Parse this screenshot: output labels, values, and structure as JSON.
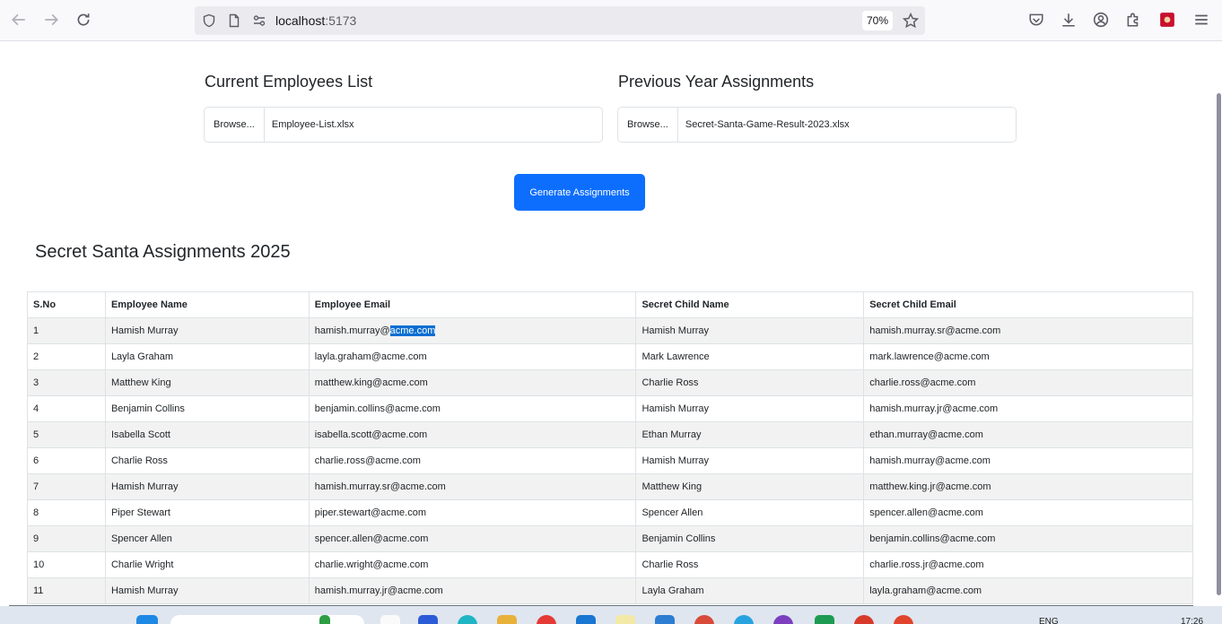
{
  "browser": {
    "url_host": "localhost",
    "url_port": ":5173",
    "zoom": "70%"
  },
  "uploads": {
    "employees": {
      "title": "Current Employees List",
      "browse_label": "Browse...",
      "file_name": "Employee-List.xlsx"
    },
    "previous": {
      "title": "Previous Year Assignments",
      "browse_label": "Browse...",
      "file_name": "Secret-Santa-Game-Result-2023.xlsx"
    }
  },
  "generate_label": "Generate Assignments",
  "results": {
    "title": "Secret Santa Assignments 2025",
    "columns": [
      "S.No",
      "Employee Name",
      "Employee Email",
      "Secret Child Name",
      "Secret Child Email"
    ],
    "rows": [
      {
        "sno": "1",
        "name": "Hamish Murray",
        "email_pre": "hamish.murray@",
        "email_sel": "acme.com",
        "child": "Hamish Murray",
        "child_email": "hamish.murray.sr@acme.com"
      },
      {
        "sno": "2",
        "name": "Layla Graham",
        "email": "layla.graham@acme.com",
        "child": "Mark Lawrence",
        "child_email": "mark.lawrence@acme.com"
      },
      {
        "sno": "3",
        "name": "Matthew King",
        "email": "matthew.king@acme.com",
        "child": "Charlie Ross",
        "child_email": "charlie.ross@acme.com"
      },
      {
        "sno": "4",
        "name": "Benjamin Collins",
        "email": "benjamin.collins@acme.com",
        "child": "Hamish Murray",
        "child_email": "hamish.murray.jr@acme.com"
      },
      {
        "sno": "5",
        "name": "Isabella Scott",
        "email": "isabella.scott@acme.com",
        "child": "Ethan Murray",
        "child_email": "ethan.murray@acme.com"
      },
      {
        "sno": "6",
        "name": "Charlie Ross",
        "email": "charlie.ross@acme.com",
        "child": "Hamish Murray",
        "child_email": "hamish.murray@acme.com"
      },
      {
        "sno": "7",
        "name": "Hamish Murray",
        "email": "hamish.murray.sr@acme.com",
        "child": "Matthew King",
        "child_email": "matthew.king.jr@acme.com"
      },
      {
        "sno": "8",
        "name": "Piper Stewart",
        "email": "piper.stewart@acme.com",
        "child": "Spencer Allen",
        "child_email": "spencer.allen@acme.com"
      },
      {
        "sno": "9",
        "name": "Spencer Allen",
        "email": "spencer.allen@acme.com",
        "child": "Benjamin Collins",
        "child_email": "benjamin.collins@acme.com"
      },
      {
        "sno": "10",
        "name": "Charlie Wright",
        "email": "charlie.wright@acme.com",
        "child": "Charlie Ross",
        "child_email": "charlie.ross.jr@acme.com"
      },
      {
        "sno": "11",
        "name": "Hamish Murray",
        "email": "hamish.murray.jr@acme.com",
        "child": "Layla Graham",
        "child_email": "layla.graham@acme.com"
      }
    ]
  },
  "taskbar": {
    "lang": "ENG",
    "time": "17:26"
  },
  "icons": [
    "back-icon",
    "forward-icon",
    "reload-icon",
    "shield-icon",
    "page-icon",
    "permissions-icon",
    "star-icon",
    "pocket-icon",
    "download-icon",
    "account-icon",
    "extensions-icon",
    "addon-icon",
    "menu-icon"
  ],
  "colors": {
    "primary": "#0d6efd",
    "selection": "#0a6ed1",
    "stripe": "#f2f2f2"
  }
}
